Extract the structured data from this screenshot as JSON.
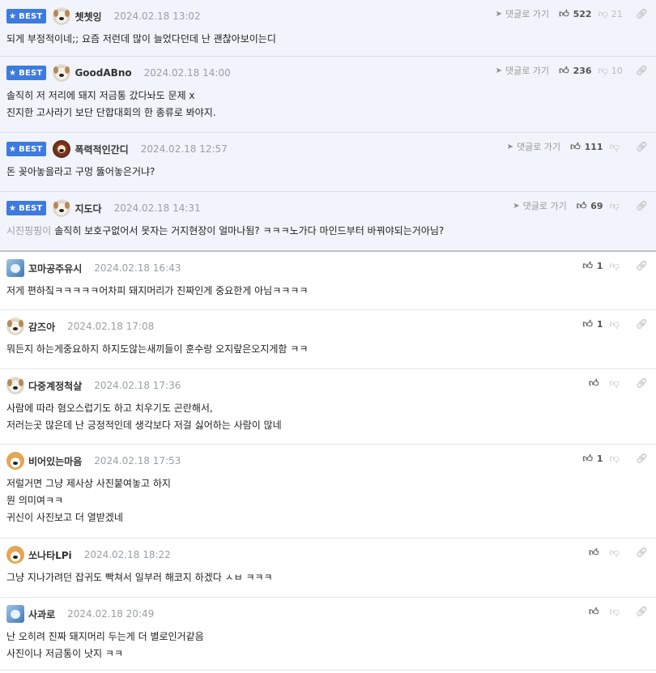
{
  "comments": [
    {
      "best": true,
      "badge": "BEST",
      "avatar": "dog-avatar",
      "nickname": "쳇쳇잉",
      "date": "2024.02.18 13:02",
      "reply_label": "댓글로 가기",
      "likes": "522",
      "dislikes": "21",
      "text": "되게 부정적이네;; 요즘 저런데 많이 늘었다던데 난 괜찮아보이는디"
    },
    {
      "best": true,
      "badge": "BEST",
      "avatar": "dog-avatar",
      "nickname": "GoodABno",
      "date": "2024.02.18 14:00",
      "reply_label": "댓글로 가기",
      "likes": "236",
      "dislikes": "10",
      "text": "솔직히 저 저리에 돼지 저금통 갔다놔도 문제 x\n진지한 고사라기 보단 단합대회의 한 종류로 봐야지."
    },
    {
      "best": true,
      "badge": "BEST",
      "avatar": "lion-avatar",
      "nickname": "폭력적인간디",
      "date": "2024.02.18 12:57",
      "reply_label": "댓글로 가기",
      "likes": "111",
      "dislikes": "",
      "text": "돈 꽂아놓을라고 구멍 뚫어놓은거냐?"
    },
    {
      "best": true,
      "badge": "BEST",
      "avatar": "dog-avatar",
      "nickname": "지도다",
      "date": "2024.02.18 14:31",
      "reply_label": "댓글로 가기",
      "likes": "69",
      "dislikes": "",
      "mention": "시진핑핑이",
      "text": "솔직히 보호구없어서 못자는 거지현장이 얼마나됨? ㅋㅋㅋ노가다 마인드부터 바꿔야되는거아님?"
    },
    {
      "best": false,
      "avatar": "picture-avatar",
      "nickname": "꼬마공주유시",
      "date": "2024.02.18 16:43",
      "likes": "1",
      "dislikes": "",
      "text": "저게 편하짘ㅋㅋㅋㅋㅋ어차피 돼지머리가 진짜인게 중요한게 아님ㅋㅋㅋㅋ"
    },
    {
      "best": false,
      "avatar": "dog-avatar",
      "nickname": "감즈아",
      "date": "2024.02.18 17:08",
      "likes": "1",
      "dislikes": "",
      "text": "뭐든지 하는게중요하지 하지도않는새끼들이 훈수랑 오지랖은오지게함 ㅋㅋ"
    },
    {
      "best": false,
      "avatar": "dog-avatar",
      "nickname": "다중계정척살",
      "date": "2024.02.18 17:36",
      "likes": "",
      "dislikes": "",
      "text": "사람에 따라 혐오스럽기도 하고 치우기도 곤란해서,\n저러는곳 많은데 난 긍정적인데 생각보다 저걸 싫어하는 사람이 많네"
    },
    {
      "best": false,
      "avatar": "shiba-avatar",
      "nickname": "비어있는마음",
      "date": "2024.02.18 17:53",
      "likes": "1",
      "dislikes": "",
      "text": "저럴거면 그냥 제사상 사진붙여놓고 하지\n뭔 의미여ㅋㅋ\n귀신이 사진보고 더 열받겠네"
    },
    {
      "best": false,
      "avatar": "shiba-avatar",
      "nickname": "쏘나타LPi",
      "date": "2024.02.18 18:22",
      "likes": "",
      "dislikes": "",
      "text": "그냥 지나가려던 잡귀도 빡쳐서 일부러 해코지 하겠다 ㅅㅂ ㅋㅋㅋ"
    },
    {
      "best": false,
      "avatar": "picture-avatar",
      "nickname": "사과로",
      "date": "2024.02.18 20:49",
      "likes": "",
      "dislikes": "",
      "text": "난 오히려 진짜 돼지머리 두는게 더 별로인거같음\n사진이나 저금통이 낫지 ㅋㅋ"
    }
  ],
  "icons": {
    "star": "star-icon",
    "reply": "reply-arrow-icon",
    "like": "thumbs-up-icon",
    "dislike": "thumbs-down-icon",
    "link": "link-icon"
  },
  "colors": {
    "badge": "#3d7be0",
    "best_bg": "#f1f4fa",
    "date": "#9aa0a6"
  }
}
